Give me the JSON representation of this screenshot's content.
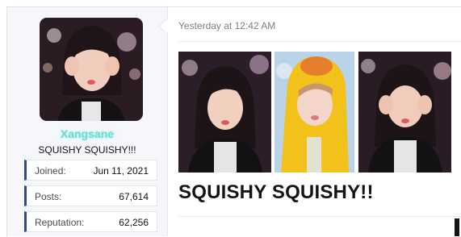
{
  "user": {
    "name": "Xangsane",
    "title": "SQUISHY SQUISHY!!!",
    "stats": [
      {
        "label": "Joined:",
        "value": "Jun 11, 2021"
      },
      {
        "label": "Posts:",
        "value": "67,614"
      },
      {
        "label": "Reputation:",
        "value": "62,256"
      }
    ],
    "name_color": "#6fd9d6",
    "stat_accent": "#2e4a80"
  },
  "post": {
    "timestamp": "Yesterday at 12:42 AM",
    "body": "SQUISHY SQUISHY!!",
    "images": [
      "photo-squish-cheeks",
      "photo-duck-costume",
      "photo-squish-cheeks-2"
    ]
  }
}
